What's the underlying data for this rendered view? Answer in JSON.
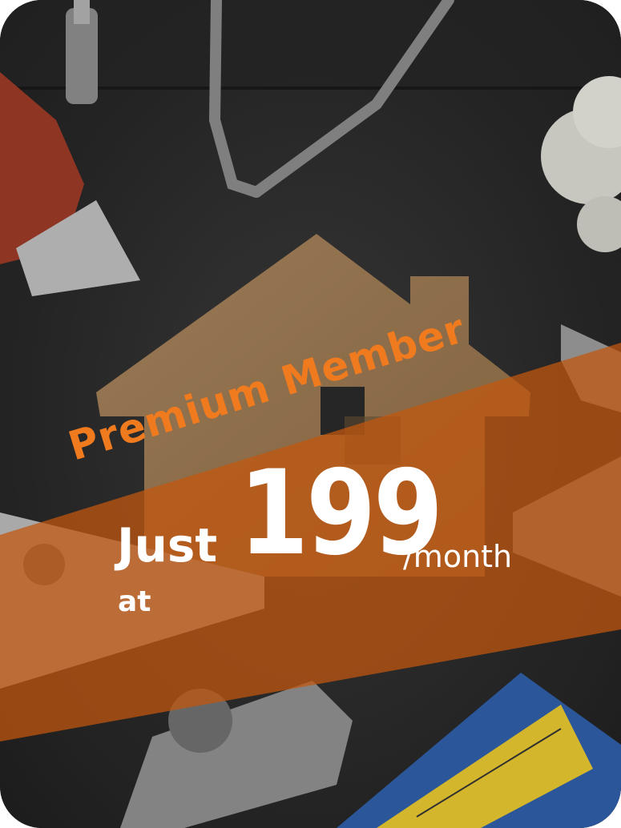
{
  "promo": {
    "badge_text": "Premium Member",
    "prefix_line1": "Just",
    "prefix_line2": "at",
    "price": "199",
    "period": "/month"
  },
  "background": {
    "subject": "house-cutout-with-tools-photo",
    "icons": [
      "house-icon",
      "utility-knife-icon",
      "wrench-icon",
      "safety-glasses-icon",
      "saw-icon",
      "tape-measure-icon",
      "screwdriver-icon",
      "mop-icon"
    ]
  },
  "colors": {
    "band": "#d25f10",
    "badge_text": "#f07a1e",
    "price_text": "#ffffff",
    "background_dark": "#2c2c2c",
    "house": "#9a7650"
  }
}
